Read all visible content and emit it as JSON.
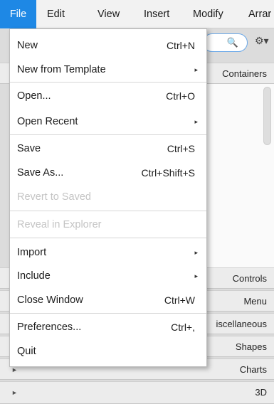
{
  "menubar": {
    "items": [
      {
        "label": "File",
        "active": true
      },
      {
        "label": "Edit"
      },
      {
        "label": "View"
      },
      {
        "label": "Insert"
      },
      {
        "label": "Modify"
      },
      {
        "label": "Arrar"
      }
    ]
  },
  "background": {
    "search_icon": "🔍",
    "gear_icon": "⚙▾",
    "panels": {
      "containers": "Containers",
      "controls": "Controls",
      "menu": "Menu",
      "miscellaneous": "iscellaneous",
      "shapes": "Shapes",
      "charts": "Charts",
      "three_d": "3D"
    },
    "arrow_glyph": "►"
  },
  "file_menu": {
    "submenu_glyph": "▸",
    "items": [
      {
        "label": "New",
        "shortcut": "Ctrl+N"
      },
      {
        "label": "New from Template",
        "submenu": true
      },
      {
        "label": "Open...",
        "shortcut": "Ctrl+O"
      },
      {
        "label": "Open Recent",
        "submenu": true
      },
      {
        "label": "Save",
        "shortcut": "Ctrl+S"
      },
      {
        "label": "Save As...",
        "shortcut": "Ctrl+Shift+S"
      },
      {
        "label": "Revert to Saved",
        "disabled": true
      },
      {
        "label": "Reveal in Explorer",
        "disabled": true
      },
      {
        "label": "Import",
        "submenu": true
      },
      {
        "label": "Include",
        "submenu": true
      },
      {
        "label": "Close Window",
        "shortcut": "Ctrl+W"
      },
      {
        "label": "Preferences...",
        "shortcut": "Ctrl+,"
      },
      {
        "label": "Quit"
      }
    ]
  },
  "colors": {
    "menu_active": "#1e88e5",
    "disabled_text": "#c4c4c4",
    "search_border": "#6aa8e8"
  }
}
